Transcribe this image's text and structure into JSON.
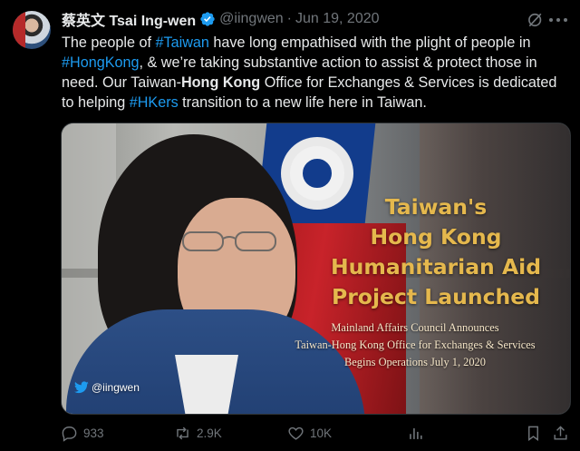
{
  "tweet": {
    "author_name": "蔡英文 Tsai Ing-wen",
    "handle": "@iingwen",
    "separator": "·",
    "date": "Jun 19, 2020",
    "text_lines": [
      [
        {
          "t": "The people of "
        },
        {
          "t": "#Taiwan",
          "tag": true
        },
        {
          "t": " have long empathised with the plight of people in"
        }
      ],
      [
        {
          "t": "#HongKong",
          "tag": true
        },
        {
          "t": ", & we’re taking substantive action to assist & protect those in"
        }
      ],
      [
        {
          "t": "need. Our Taiwan-"
        },
        {
          "t": "Hong Kong",
          "bold": true
        },
        {
          "t": " Office for Exchanges & Services is dedicated"
        }
      ],
      [
        {
          "t": "to helping "
        },
        {
          "t": "#HKers",
          "tag": true
        },
        {
          "t": " transition to a new life here in Taiwan."
        }
      ]
    ]
  },
  "media": {
    "title_lines": [
      "Taiwan's",
      "Hong Kong",
      "Humanitarian Aid",
      "Project Launched"
    ],
    "subtitle_lines": [
      "Mainland Affairs Council Announces",
      "Taiwan-Hong Kong Office for Exchanges & Services",
      "Begins Operations July 1, 2020"
    ],
    "watermark": "@iingwen"
  },
  "actions": {
    "replies": "933",
    "retweets": "2.9K",
    "likes": "10K"
  },
  "colors": {
    "background": "#000000",
    "text": "#e7e9ea",
    "secondary": "#71767b",
    "link": "#1d9bf0",
    "verified": "#1d9bf0",
    "overlay_title": "#e5b84d"
  }
}
